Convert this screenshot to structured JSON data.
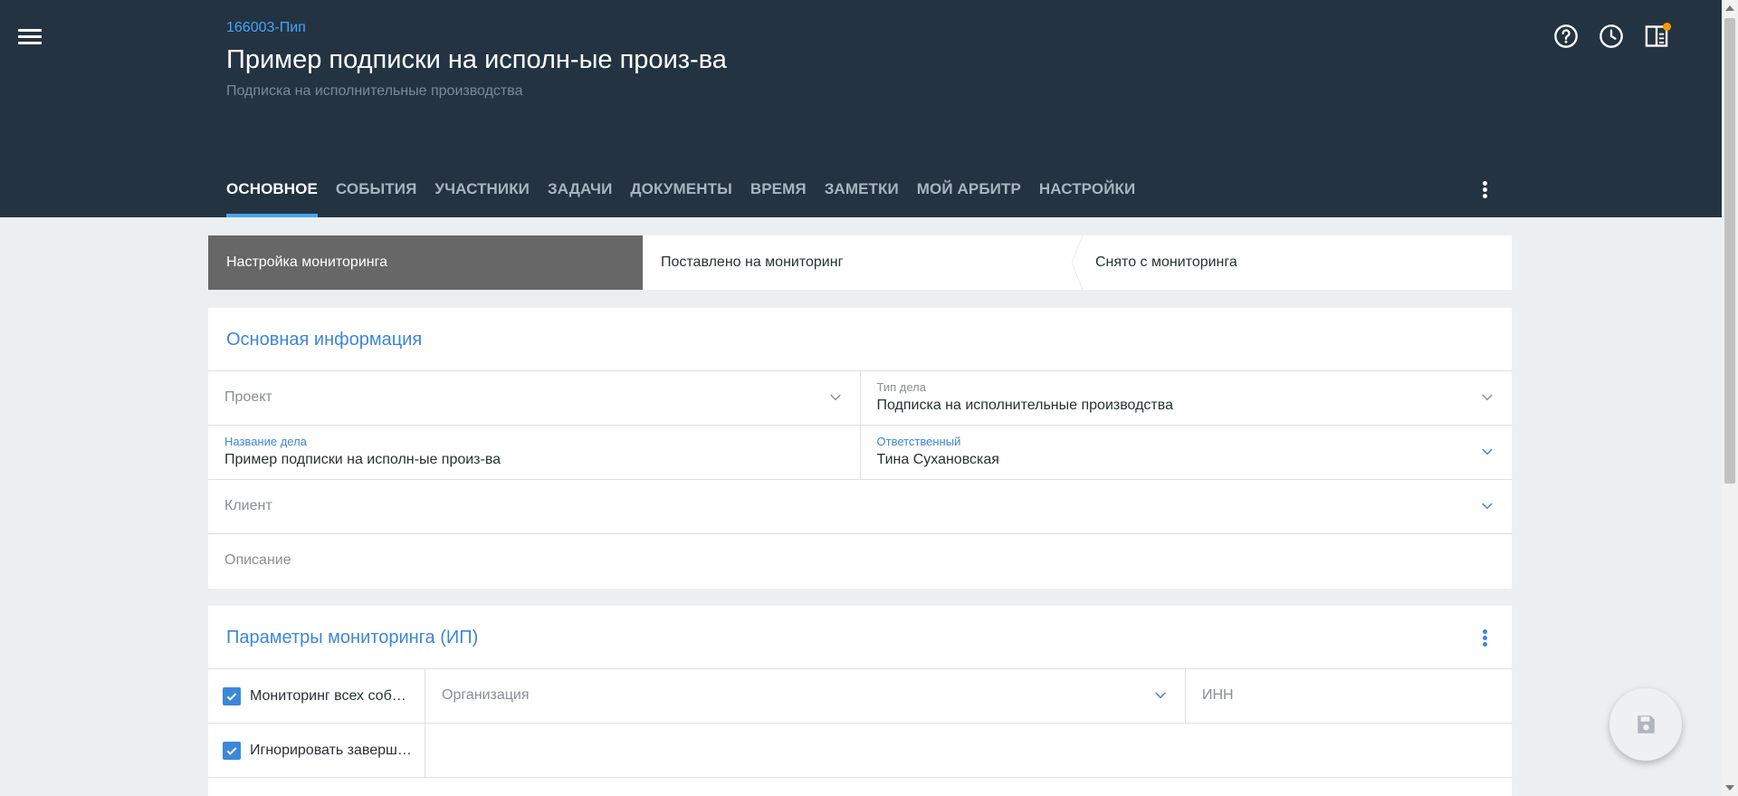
{
  "header": {
    "case_code": "166003-Пип",
    "title": "Пример подписки на исполн-ые произ-ва",
    "subtitle": "Подписка на исполнительные производства",
    "icons": [
      "help-icon",
      "history-icon",
      "panel-icon"
    ],
    "notification_color": "#ff9800"
  },
  "tabs": [
    {
      "label": "ОСНОВНОЕ",
      "active": true
    },
    {
      "label": "СОБЫТИЯ"
    },
    {
      "label": "УЧАСТНИКИ"
    },
    {
      "label": "ЗАДАЧИ"
    },
    {
      "label": "ДОКУМЕНТЫ"
    },
    {
      "label": "ВРЕМЯ"
    },
    {
      "label": "ЗАМЕТКИ"
    },
    {
      "label": "МОЙ АРБИТР"
    },
    {
      "label": "НАСТРОЙКИ"
    }
  ],
  "stepper": [
    {
      "label": "Настройка мониторинга",
      "active": true
    },
    {
      "label": "Поставлено на мониторинг"
    },
    {
      "label": "Снято с мониторинга"
    }
  ],
  "main_info": {
    "title": "Основная информация",
    "project_placeholder": "Проект",
    "case_type_label": "Тип дела",
    "case_type_value": "Подписка на исполнительные производства",
    "case_name_label": "Название дела",
    "case_name_value": "Пример подписки на исполн-ые произ-ва",
    "responsible_label": "Ответственный",
    "responsible_value": "Тина Сухановская",
    "client_placeholder": "Клиент",
    "description_placeholder": "Описание"
  },
  "monitoring": {
    "title": "Параметры мониторинга (ИП)",
    "checkbox_all_events": "Мониторинг всех соб…",
    "checkbox_ignore": "Игнорировать заверш…",
    "organization_placeholder": "Организация",
    "inn_placeholder": "ИНН"
  },
  "colors": {
    "header_bg": "#243342",
    "accent": "#3b87d9",
    "tab_indicator": "#42a5f5",
    "step_active": "#676767"
  }
}
